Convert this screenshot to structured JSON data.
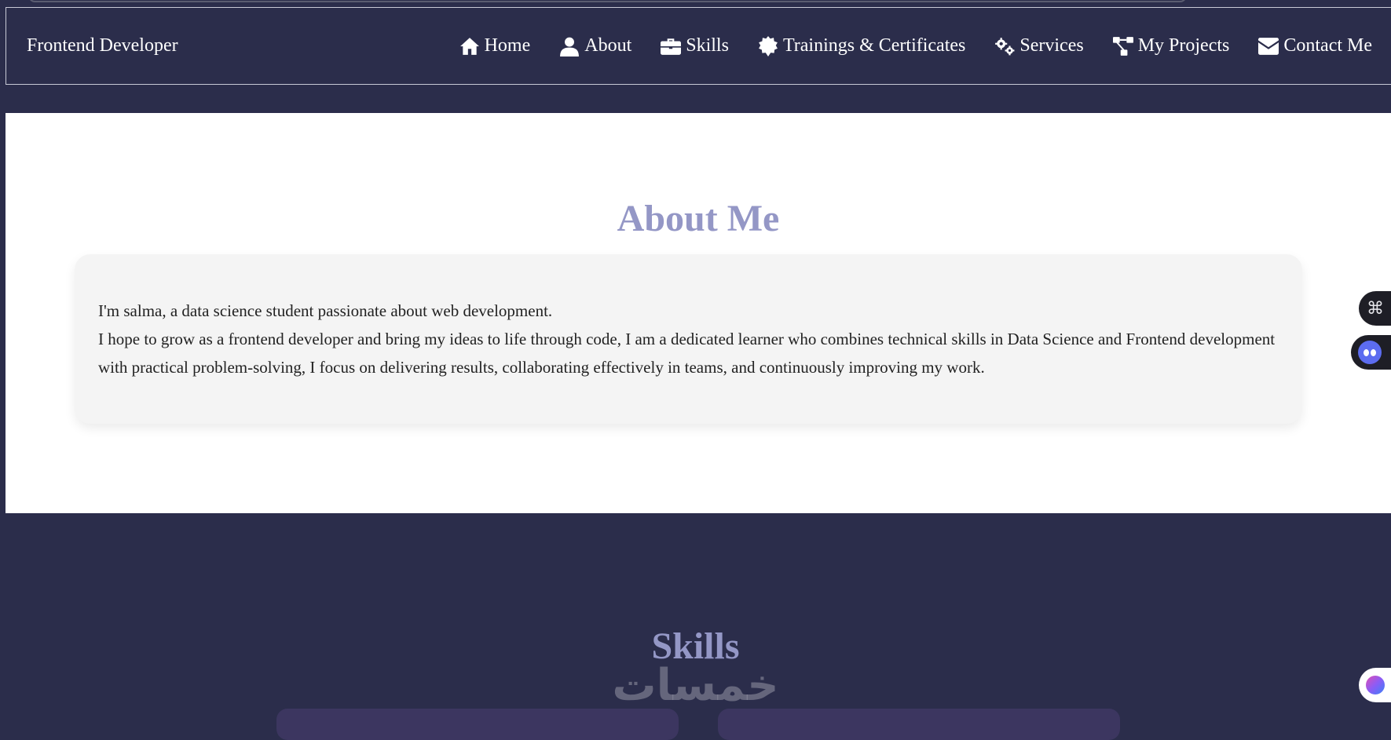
{
  "navbar": {
    "brand": "Frontend Developer",
    "links": [
      {
        "label": "Home",
        "icon": "home-icon"
      },
      {
        "label": "About",
        "icon": "user-icon"
      },
      {
        "label": "Skills",
        "icon": "briefcase-icon"
      },
      {
        "label": "Trainings & Certificates",
        "icon": "certificate-icon"
      },
      {
        "label": "Services",
        "icon": "gears-icon"
      },
      {
        "label": "My Projects",
        "icon": "project-diagram-icon"
      },
      {
        "label": "Contact Me",
        "icon": "envelope-icon"
      }
    ]
  },
  "about": {
    "title": "About Me",
    "line1": "I'm salma, a data science student passionate about web development.",
    "line2": "I hope to grow as a frontend developer and bring my ideas to life through code, I am a dedicated learner who combines technical skills in Data Science and Frontend development with practical problem-solving, I focus on delivering results, collaborating effectively in teams, and continuously improving my work."
  },
  "skills": {
    "title": "Skills"
  },
  "watermark": {
    "text": "خمسات"
  },
  "floating": {
    "grid_glyph": "⌘"
  },
  "colors": {
    "background": "#2b2d4b",
    "heading": "#9497c6",
    "card": "#f4f4f4"
  }
}
